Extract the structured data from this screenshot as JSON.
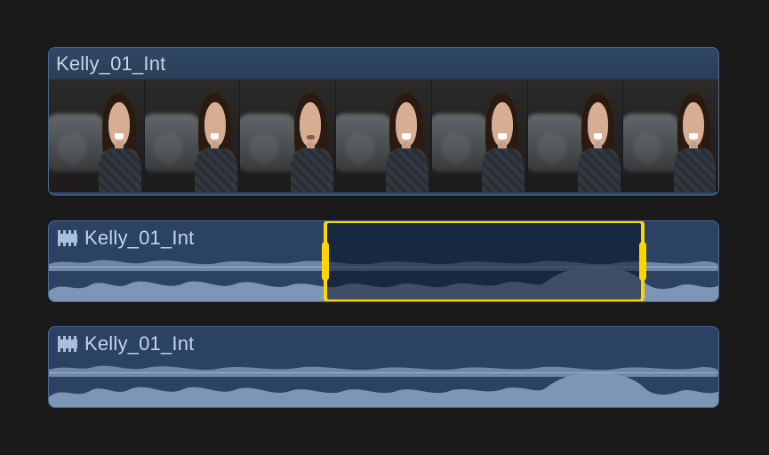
{
  "colors": {
    "selection": "#ffd400",
    "clip_bg": "#2b4264",
    "waveform": "#7e96b5",
    "text": "#c3d5ea"
  },
  "clips": [
    {
      "kind": "video",
      "name": "Kelly_01_Int",
      "thumbnails": 7
    },
    {
      "kind": "audio",
      "name": "Kelly_01_Int",
      "range_selection": {
        "start_pct": 41.0,
        "end_pct": 89.0
      }
    },
    {
      "kind": "audio",
      "name": "Kelly_01_Int"
    }
  ]
}
